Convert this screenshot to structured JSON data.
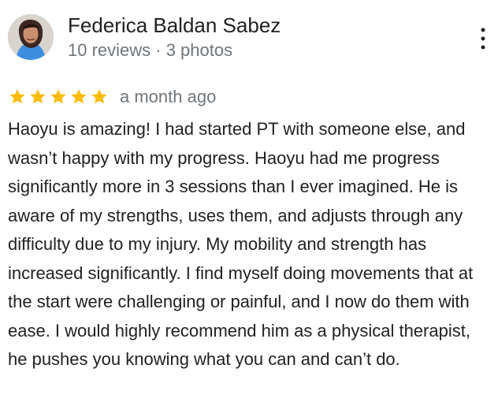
{
  "reviewer": {
    "name": "Federica Baldan Sabez",
    "meta": "10 reviews · 3 photos",
    "avatar_icon": "profile-photo"
  },
  "review": {
    "rating": 5,
    "rating_max": 5,
    "time_ago": "a month ago",
    "text": "Haoyu is amazing! I had started PT with someone else, and wasn’t happy with my progress. Haoyu had me progress significantly more in 3 sessions than I ever imagined. He is aware of my strengths, uses them, and adjusts through any difficulty due to my injury. My mobility and strength has increased significantly. I find myself doing movements that at the start were challenging or painful, and I now do them with ease. I would highly recommend him as a physical therapist, he pushes you knowing what you can and can’t do."
  },
  "icons": {
    "more": "more-vert-icon",
    "star": "star-icon"
  },
  "colors": {
    "star": "#fbbc04",
    "text": "#202124",
    "secondary_text": "#70757a"
  }
}
